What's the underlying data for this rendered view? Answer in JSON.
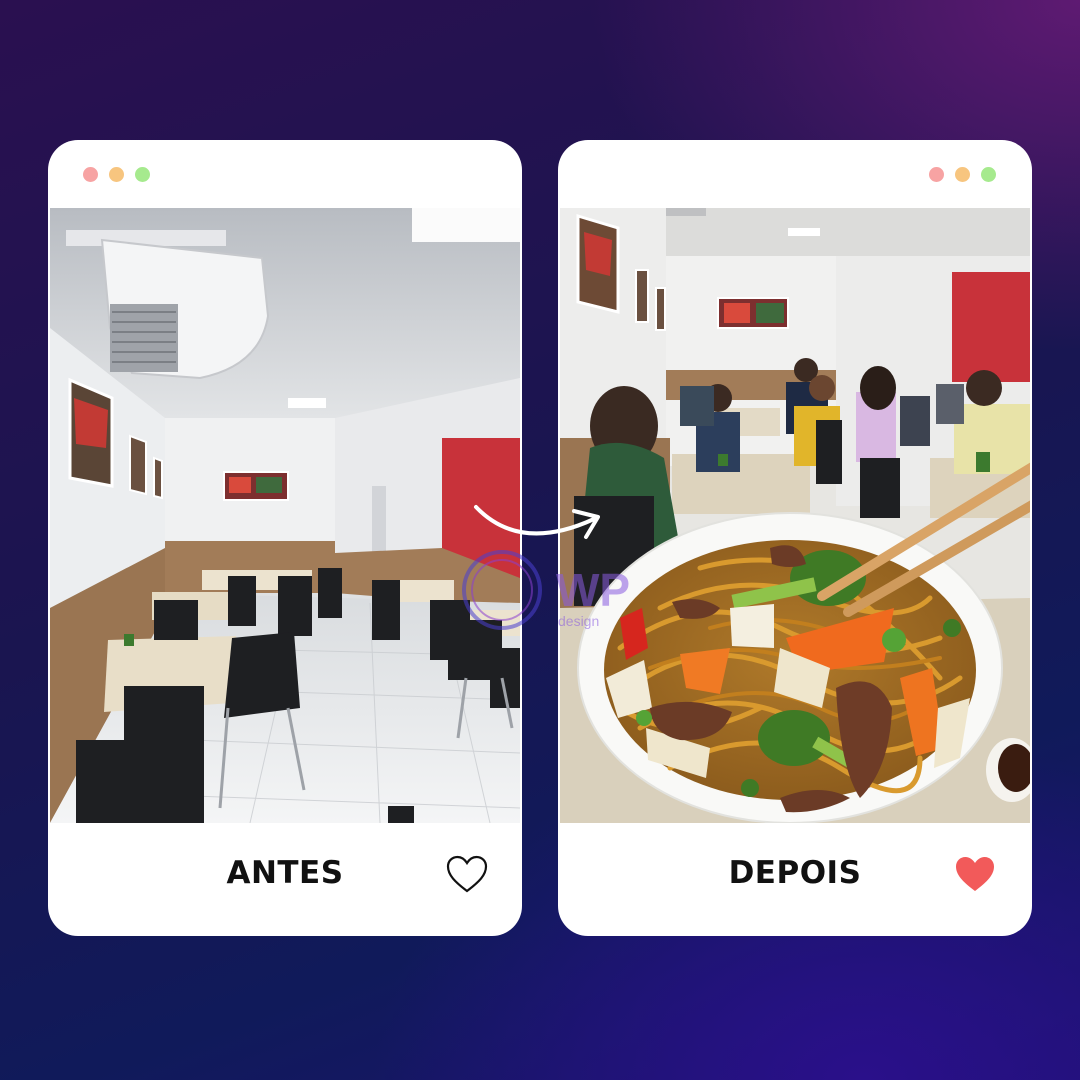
{
  "before": {
    "label": "ANTES",
    "heart_icon": "heart-outline-icon"
  },
  "after": {
    "label": "DEPOIS",
    "heart_icon": "heart-filled-icon"
  },
  "window_dots": [
    "#f7a3a3",
    "#f7c57f",
    "#a6ea8e"
  ],
  "colors": {
    "card_background": "#ffffff",
    "heart_filled": "#f25a5a",
    "label_text": "#111111",
    "accent_wall": "#c8323a"
  },
  "watermark": {
    "logo_text": "WP",
    "sub_text": "design"
  }
}
